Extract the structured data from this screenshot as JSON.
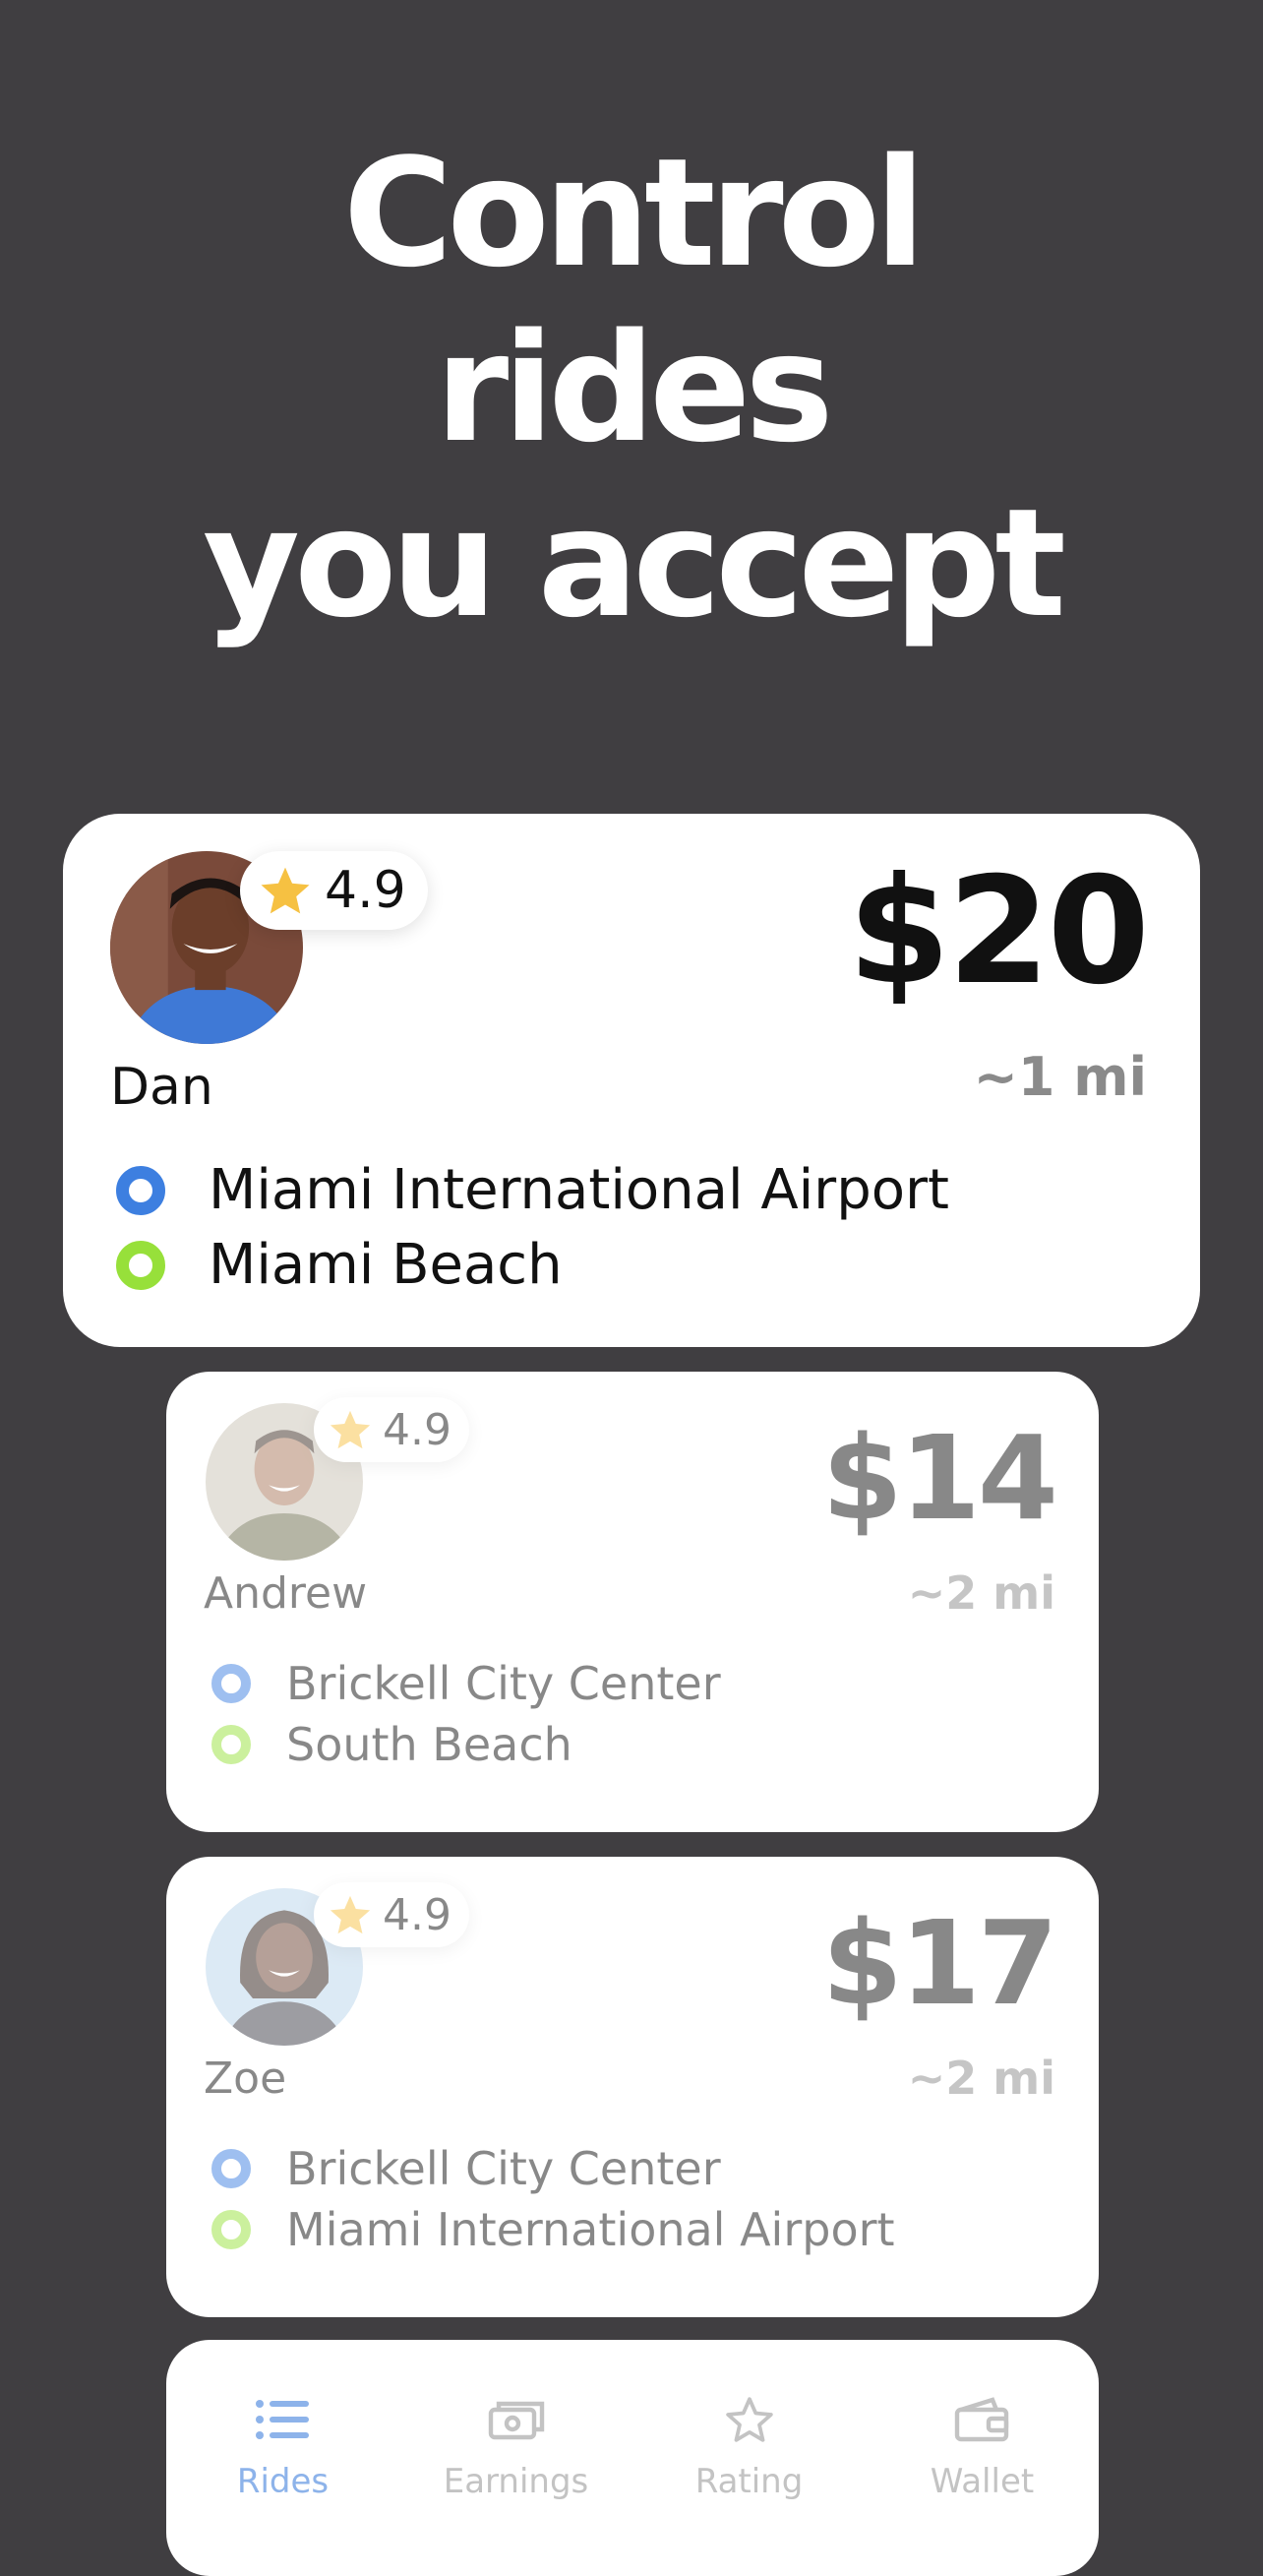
{
  "headline": [
    "Control",
    "rides",
    "you accept"
  ],
  "colors": {
    "background": "#403e41",
    "card": "#ffffff",
    "pickup_dot": "#3d7fe0",
    "dropoff_dot": "#97e03a",
    "star": "#f6c142",
    "nav_active": "#8db3ea",
    "nav_inactive": "#c3c3c3"
  },
  "rides": [
    {
      "name": "Dan",
      "rating": "4.9",
      "price": "$20",
      "distance": "~1 mi",
      "pickup": "Miami International Airport",
      "dropoff": "Miami Beach",
      "avatar_icon": "rider-photo-dan"
    },
    {
      "name": "Andrew",
      "rating": "4.9",
      "price": "$14",
      "distance": "~2 mi",
      "pickup": "Brickell City Center",
      "dropoff": "South Beach",
      "avatar_icon": "rider-photo-andrew"
    },
    {
      "name": "Zoe",
      "rating": "4.9",
      "price": "$17",
      "distance": "~2 mi",
      "pickup": "Brickell City Center",
      "dropoff": "Miami International Airport",
      "avatar_icon": "rider-photo-zoe"
    }
  ],
  "nav": {
    "active": "Rides",
    "items": [
      {
        "label": "Rides",
        "icon": "list-icon"
      },
      {
        "label": "Earnings",
        "icon": "banknote-icon"
      },
      {
        "label": "Rating",
        "icon": "star-outline-icon"
      },
      {
        "label": "Wallet",
        "icon": "wallet-icon"
      }
    ]
  }
}
